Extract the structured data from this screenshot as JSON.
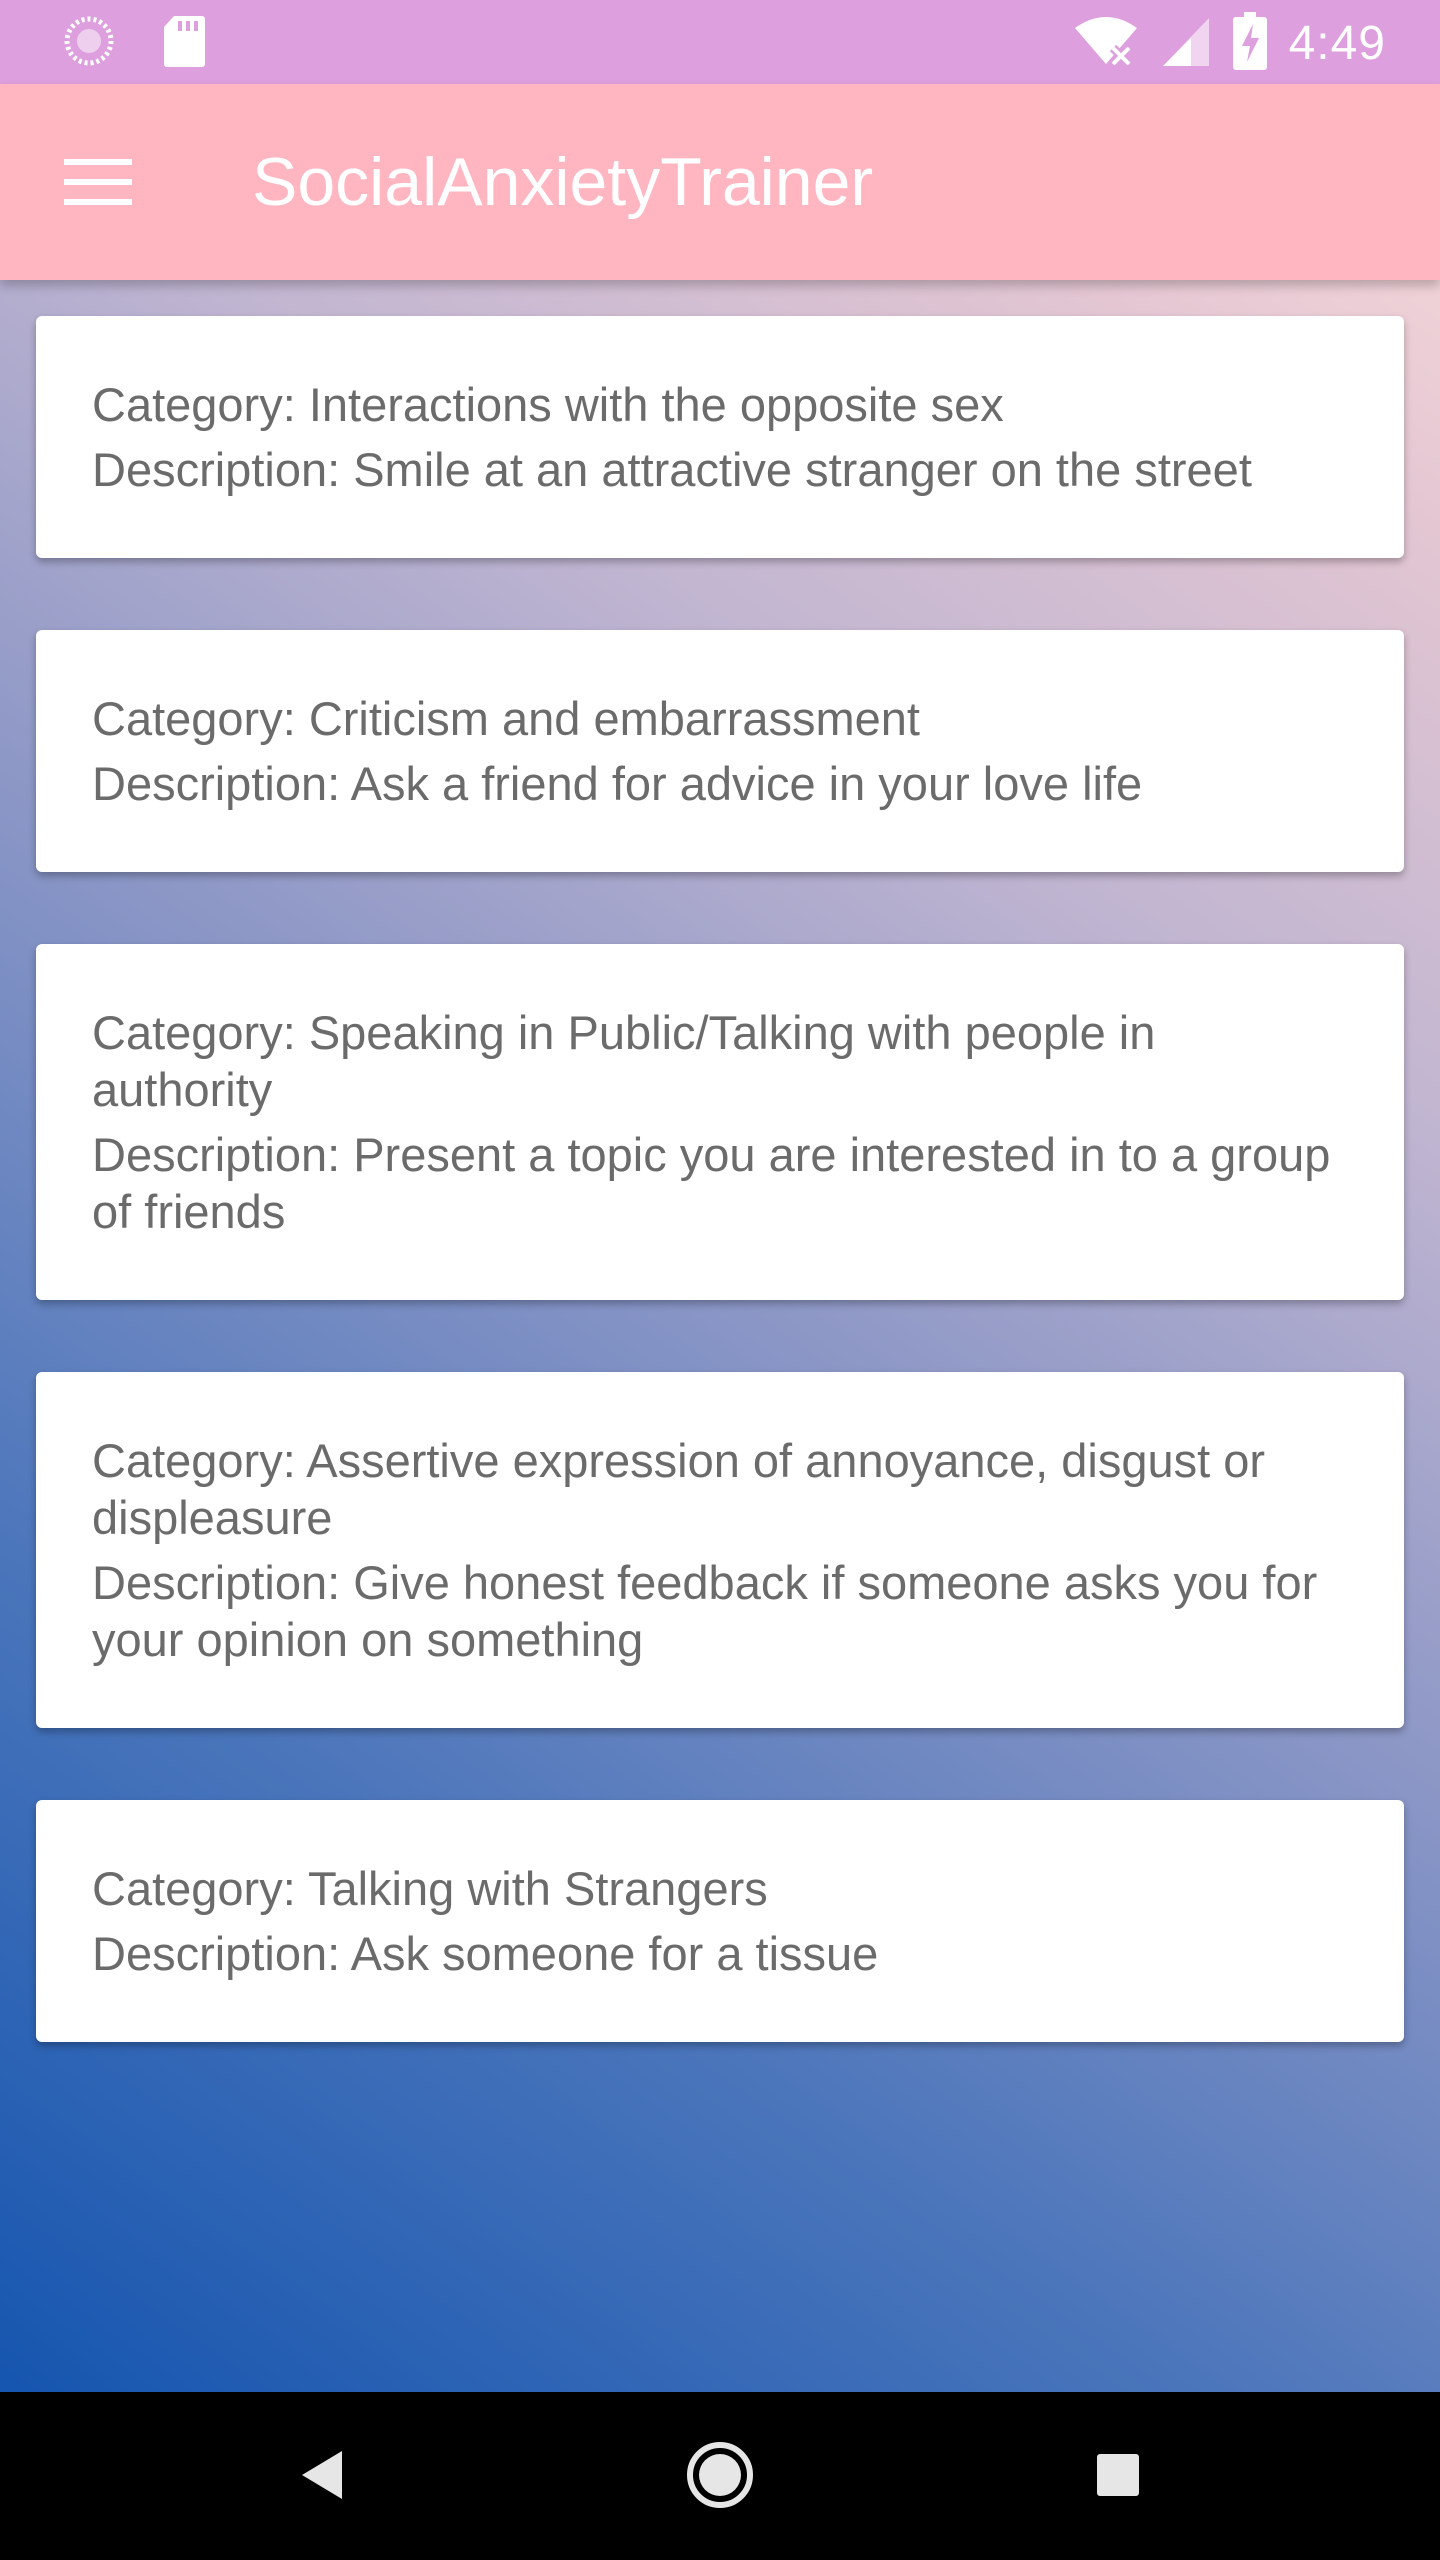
{
  "status_bar": {
    "time": "4:49",
    "icons": [
      "loading-circle-icon",
      "sd-card-icon",
      "wifi-off-icon",
      "cell-signal-icon",
      "battery-charging-icon"
    ]
  },
  "app_bar": {
    "title": "SocialAnxietyTrainer",
    "menu_icon": "hamburger-menu-icon",
    "background": "#ffb6c1"
  },
  "cards": [
    {
      "category": "Category: Interactions with the opposite sex",
      "description": "Description: Smile at an attractive stranger on the street"
    },
    {
      "category": "Category: Criticism and embarrassment",
      "description": "Description: Ask a friend for advice in your love life"
    },
    {
      "category": "Category: Speaking in Public/Talking with people in authority",
      "description": "Description: Present a topic you are interested in to a group of friends"
    },
    {
      "category": "Category: Assertive expression of annoyance, disgust or displeasure",
      "description": "Description: Give honest feedback if someone asks you for your opinion on something"
    },
    {
      "category": "Category: Talking with Strangers",
      "description": "Description: Ask someone for a tissue"
    }
  ],
  "nav_bar": {
    "icons": [
      "back-icon",
      "home-icon",
      "recents-icon"
    ]
  }
}
